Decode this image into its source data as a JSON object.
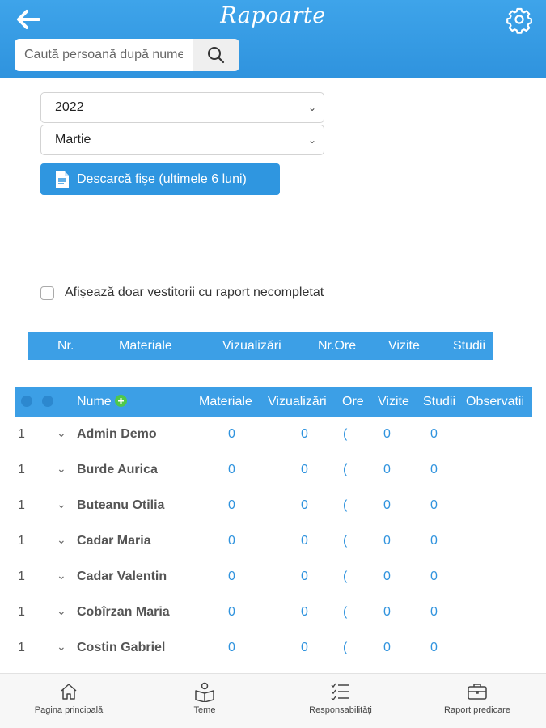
{
  "header": {
    "title": "Rapoarte"
  },
  "search": {
    "placeholder": "Caută persoană după nume"
  },
  "filters": {
    "year": "2022",
    "month": "Martie",
    "download_label": "Descarcă fișe (ultimele 6 luni)",
    "incomplete_only_label": "Afișează doar vestitorii cu raport necompletat"
  },
  "summary_bar": {
    "columns": [
      "Nr.",
      "Materiale",
      "Vizualizări",
      "Nr.Ore",
      "Vizite",
      "Studii"
    ]
  },
  "table": {
    "headers": {
      "name": "Nume",
      "materials": "Materiale",
      "views": "Vizualizări",
      "hours": "Ore",
      "visits": "Vizite",
      "studies": "Studii",
      "notes": "Observatii"
    },
    "rows": [
      {
        "nr": "1",
        "name": "Admin Demo",
        "materials": "0",
        "views": "0",
        "hours": "(",
        "visits": "0",
        "studies": "0"
      },
      {
        "nr": "1",
        "name": "Burde Aurica",
        "materials": "0",
        "views": "0",
        "hours": "(",
        "visits": "0",
        "studies": "0"
      },
      {
        "nr": "1",
        "name": "Buteanu Otilia",
        "materials": "0",
        "views": "0",
        "hours": "(",
        "visits": "0",
        "studies": "0"
      },
      {
        "nr": "1",
        "name": "Cadar Maria",
        "materials": "0",
        "views": "0",
        "hours": "(",
        "visits": "0",
        "studies": "0"
      },
      {
        "nr": "1",
        "name": "Cadar Valentin",
        "materials": "0",
        "views": "0",
        "hours": "(",
        "visits": "0",
        "studies": "0"
      },
      {
        "nr": "1",
        "name": "Cobîrzan Maria",
        "materials": "0",
        "views": "0",
        "hours": "(",
        "visits": "0",
        "studies": "0"
      },
      {
        "nr": "1",
        "name": "Costin Gabriel",
        "materials": "0",
        "views": "0",
        "hours": "(",
        "visits": "0",
        "studies": "0"
      }
    ]
  },
  "tabbar": {
    "home": "Pagina principală",
    "topics": "Teme",
    "responsibilities": "Responsabilități",
    "preaching_report": "Raport predicare"
  },
  "colors": {
    "primary": "#2f93de",
    "header_gradient_top": "#3ea4ea",
    "add_green": "#4fc84a"
  }
}
